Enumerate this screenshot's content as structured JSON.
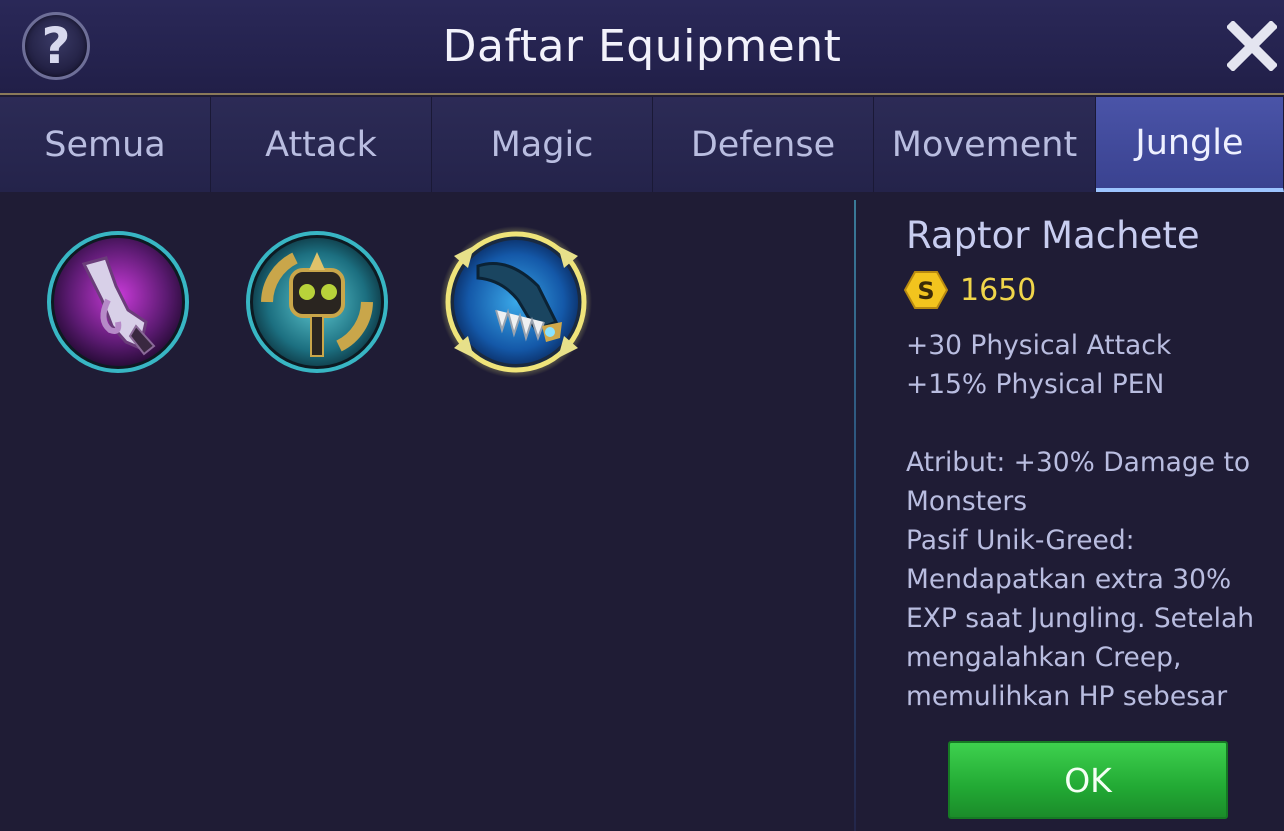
{
  "header": {
    "title": "Daftar Equipment",
    "help_label": "?"
  },
  "tabs": [
    {
      "label": "Semua",
      "active": false
    },
    {
      "label": "Attack",
      "active": false
    },
    {
      "label": "Magic",
      "active": false
    },
    {
      "label": "Defense",
      "active": false
    },
    {
      "label": "Movement",
      "active": false
    },
    {
      "label": "Jungle",
      "active": true
    }
  ],
  "items": [
    {
      "icon": "purple-blade-icon",
      "selected": false
    },
    {
      "icon": "spiked-mace-icon",
      "selected": false
    },
    {
      "icon": "raptor-machete-icon",
      "selected": true
    }
  ],
  "details": {
    "name": "Raptor Machete",
    "currency_icon": "gold-coin-icon",
    "price": "1650",
    "description": "+30 Physical Attack\n+15% Physical PEN\n\nAtribut: +30% Damage to Monsters\nPasif Unik-Greed: Mendapatkan extra 30% EXP saat Jungling. Setelah mengalahkan Creep, memulihkan HP sebesar"
  },
  "ok_label": "OK",
  "colors": {
    "background": "#1f1c35",
    "active_tab": "#4a54a8",
    "price": "#f0d54a",
    "ok_button": "#22a934"
  }
}
